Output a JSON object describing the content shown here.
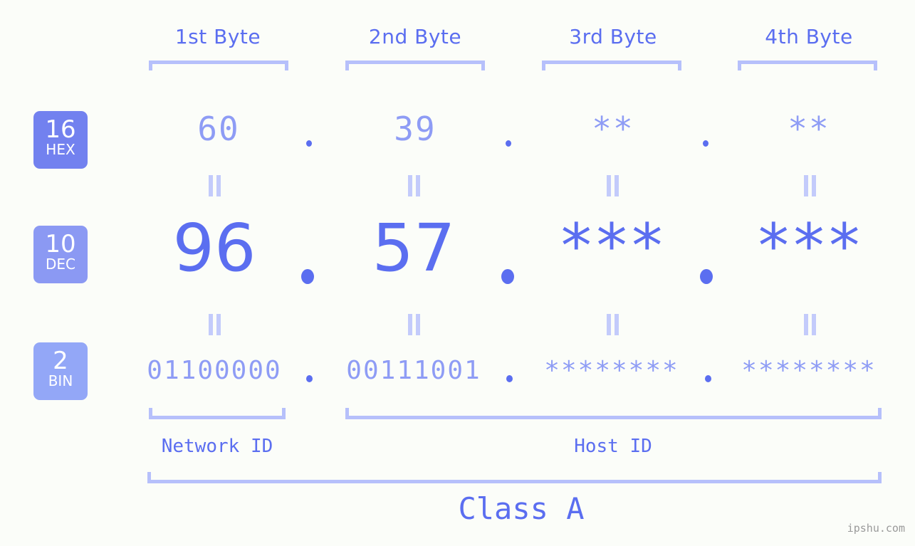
{
  "background_color": "#fbfdf9",
  "accent_color": "#5b6ef0",
  "accent_light_color": "#8e9cf5",
  "bracket_color": "#b6c0fb",
  "byte_headers": [
    {
      "label": "1st Byte"
    },
    {
      "label": "2nd Byte"
    },
    {
      "label": "3rd Byte"
    },
    {
      "label": "4th Byte"
    }
  ],
  "bases": [
    {
      "number": "16",
      "name": "HEX",
      "color": "#7281ef"
    },
    {
      "number": "10",
      "name": "DEC",
      "color": "#8b99f3"
    },
    {
      "number": "2",
      "name": "BIN",
      "color": "#93a7f7"
    }
  ],
  "rows": {
    "hex": {
      "values": [
        "60",
        "39",
        "**",
        "**"
      ]
    },
    "dec": {
      "values": [
        "96",
        "57",
        "***",
        "***"
      ]
    },
    "bin": {
      "values": [
        "01100000",
        "00111001",
        "********",
        "********"
      ]
    }
  },
  "separators": {
    "symbol": "."
  },
  "equals_marks": {
    "symbol": "||"
  },
  "id_labels": [
    {
      "label": "Network ID"
    },
    {
      "label": "Host ID"
    }
  ],
  "class_label": "Class A",
  "watermark": "ipshu.com"
}
